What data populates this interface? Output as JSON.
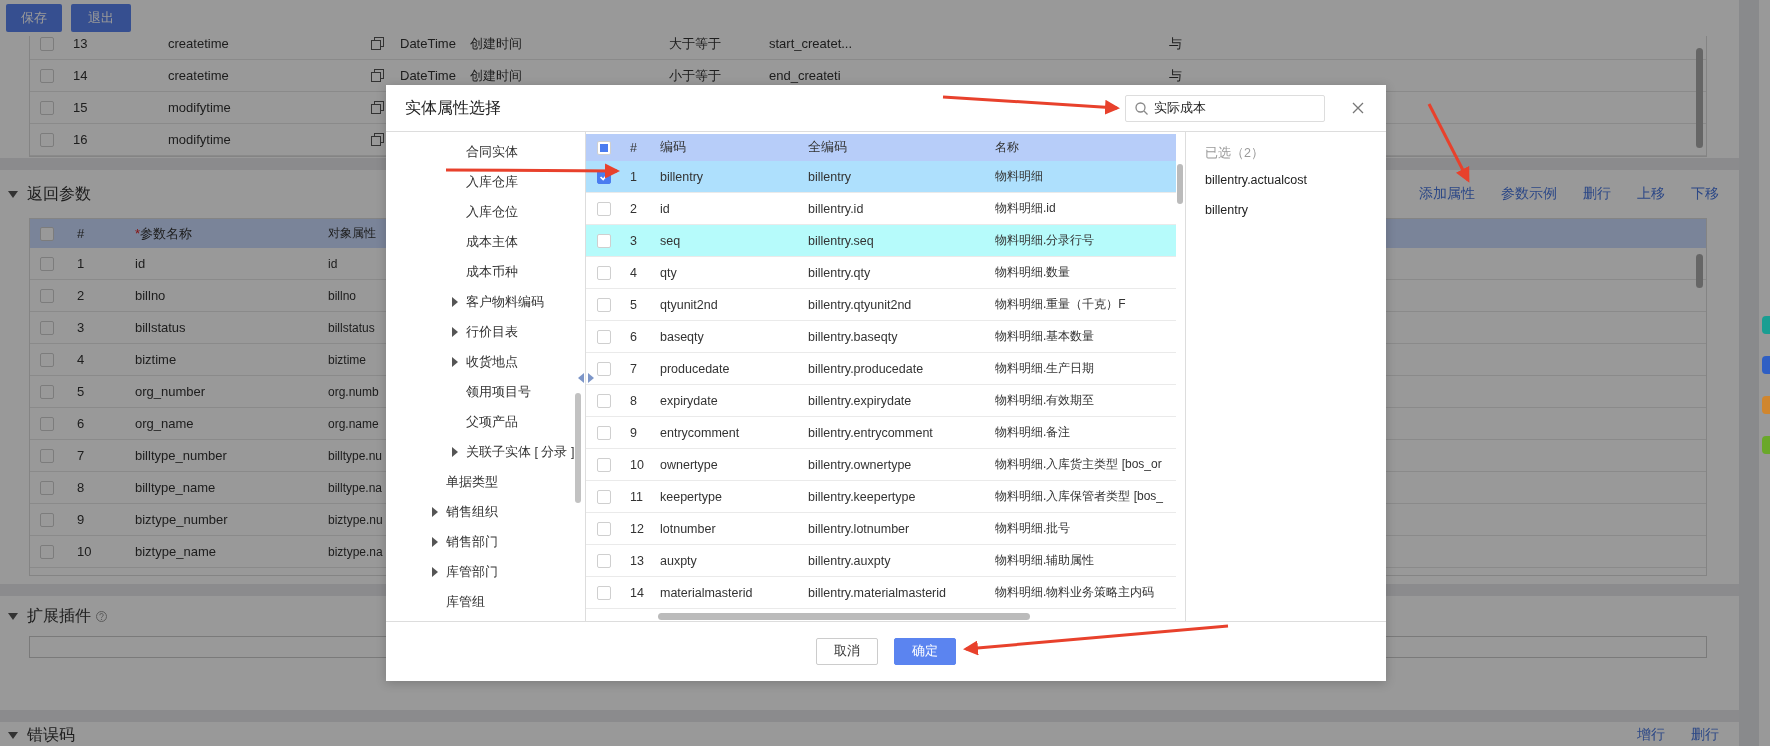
{
  "toolbar": {
    "buttons": [
      {
        "label": "保存"
      },
      {
        "label": "退出"
      }
    ]
  },
  "conditions_table": {
    "rows": [
      {
        "index": "13",
        "checked": false,
        "field": "createtime",
        "type": "DateTime",
        "label": "创建时间",
        "operator": "大于等于",
        "param": "start_createt...",
        "logic": "与"
      },
      {
        "index": "14",
        "checked": false,
        "field": "createtime",
        "type": "DateTime",
        "label": "创建时间",
        "operator": "小于等于",
        "param": "end_createti",
        "logic": "与"
      },
      {
        "index": "15",
        "checked": false,
        "field": "modifytime"
      },
      {
        "index": "16",
        "checked": false,
        "field": "modifytime"
      }
    ]
  },
  "return_params": {
    "title": "返回参数",
    "expanded": true,
    "actions": [
      "添加属性",
      "参数示例",
      "删行",
      "上移",
      "下移"
    ],
    "table": {
      "header_checked": false,
      "columns": [
        {
          "label": "#"
        },
        {
          "label": "参数名称",
          "required_mark": "*"
        },
        {
          "label": "对象属性"
        }
      ],
      "rows": [
        {
          "index": "1",
          "checked": false,
          "name": "id",
          "property": "id"
        },
        {
          "index": "2",
          "checked": false,
          "name": "billno",
          "property": "billno"
        },
        {
          "index": "3",
          "checked": false,
          "name": "billstatus",
          "property": "billstatus"
        },
        {
          "index": "4",
          "checked": false,
          "name": "biztime",
          "property": "biztime"
        },
        {
          "index": "5",
          "checked": false,
          "name": "org_number",
          "property": "org.numb"
        },
        {
          "index": "6",
          "checked": false,
          "name": "org_name",
          "property": "org.name"
        },
        {
          "index": "7",
          "checked": false,
          "name": "billtype_number",
          "property": "billtype.nu"
        },
        {
          "index": "8",
          "checked": false,
          "name": "billtype_name",
          "property": "billtype.na"
        },
        {
          "index": "9",
          "checked": false,
          "name": "biztype_number",
          "property": "biztype.nu"
        },
        {
          "index": "10",
          "checked": false,
          "name": "biztype_name",
          "property": "biztype.na"
        }
      ]
    }
  },
  "extensions": {
    "title": "扩展插件",
    "expanded": true
  },
  "error_codes": {
    "title": "错误码",
    "expanded": true,
    "actions": [
      "增行",
      "删行"
    ]
  },
  "side_tabs": [
    {
      "color": "#1a9e92"
    },
    {
      "color": "#2f5fc4"
    },
    {
      "color": "#d0862e"
    },
    {
      "color": "#6aa82a"
    }
  ],
  "dialog": {
    "title": "实体属性选择",
    "search": {
      "value": "实际成本"
    },
    "tree": {
      "items": [
        {
          "kind": "group",
          "children": [
            {
              "kind": "leaf",
              "label": "合同实体"
            },
            {
              "kind": "leaf",
              "label": "入库仓库"
            },
            {
              "kind": "leaf",
              "label": "入库仓位"
            },
            {
              "kind": "leaf",
              "label": "成本主体"
            },
            {
              "kind": "leaf",
              "label": "成本币种"
            },
            {
              "kind": "branch",
              "label": "客户物料编码",
              "expanded": false
            },
            {
              "kind": "branch",
              "label": "行价目表",
              "expanded": false
            },
            {
              "kind": "branch",
              "label": "收货地点",
              "expanded": false
            },
            {
              "kind": "leaf",
              "label": "领用项目号"
            },
            {
              "kind": "leaf",
              "label": "父项产品"
            },
            {
              "kind": "branch",
              "label": "关联子实体 [ 分录 ]",
              "expanded": false
            }
          ]
        },
        {
          "kind": "leaf",
          "label": "单据类型"
        },
        {
          "kind": "branch",
          "label": "销售组织",
          "expanded": false
        },
        {
          "kind": "branch",
          "label": "销售部门",
          "expanded": false
        },
        {
          "kind": "branch",
          "label": "库管部门",
          "expanded": false
        },
        {
          "kind": "leaf",
          "label": "库管组"
        }
      ]
    },
    "table": {
      "select_all_checked": false,
      "select_all_partial": true,
      "columns": [
        "#",
        "编码",
        "全编码",
        "名称"
      ],
      "rows": [
        {
          "index": "1",
          "checked": true,
          "selected": true,
          "hovered": false,
          "code": "billentry",
          "full_code": "billentry",
          "name": "物料明细"
        },
        {
          "index": "2",
          "checked": false,
          "selected": false,
          "hovered": false,
          "code": "id",
          "full_code": "billentry.id",
          "name": "物料明细.id"
        },
        {
          "index": "3",
          "checked": false,
          "selected": false,
          "hovered": true,
          "code": "seq",
          "full_code": "billentry.seq",
          "name": "物料明细.分录行号"
        },
        {
          "index": "4",
          "checked": false,
          "selected": false,
          "hovered": false,
          "code": "qty",
          "full_code": "billentry.qty",
          "name": "物料明细.数量"
        },
        {
          "index": "5",
          "checked": false,
          "selected": false,
          "hovered": false,
          "code": "qtyunit2nd",
          "full_code": "billentry.qtyunit2nd",
          "name": "物料明细.重量（千克）F"
        },
        {
          "index": "6",
          "checked": false,
          "selected": false,
          "hovered": false,
          "code": "baseqty",
          "full_code": "billentry.baseqty",
          "name": "物料明细.基本数量"
        },
        {
          "index": "7",
          "checked": false,
          "selected": false,
          "hovered": false,
          "code": "producedate",
          "full_code": "billentry.producedate",
          "name": "物料明细.生产日期"
        },
        {
          "index": "8",
          "checked": false,
          "selected": false,
          "hovered": false,
          "code": "expirydate",
          "full_code": "billentry.expirydate",
          "name": "物料明细.有效期至"
        },
        {
          "index": "9",
          "checked": false,
          "selected": false,
          "hovered": false,
          "code": "entrycomment",
          "full_code": "billentry.entrycomment",
          "name": "物料明细.备注"
        },
        {
          "index": "10",
          "checked": false,
          "selected": false,
          "hovered": false,
          "code": "ownertype",
          "full_code": "billentry.ownertype",
          "name": "物料明细.入库货主类型 [bos_or"
        },
        {
          "index": "11",
          "checked": false,
          "selected": false,
          "hovered": false,
          "code": "keepertype",
          "full_code": "billentry.keepertype",
          "name": "物料明细.入库保管者类型 [bos_"
        },
        {
          "index": "12",
          "checked": false,
          "selected": false,
          "hovered": false,
          "code": "lotnumber",
          "full_code": "billentry.lotnumber",
          "name": "物料明细.批号"
        },
        {
          "index": "13",
          "checked": false,
          "selected": false,
          "hovered": false,
          "code": "auxpty",
          "full_code": "billentry.auxpty",
          "name": "物料明细.辅助属性"
        },
        {
          "index": "14",
          "checked": false,
          "selected": false,
          "hovered": false,
          "code": "materialmasterid",
          "full_code": "billentry.materialmasterid",
          "name": "物料明细.物料业务策略主内码"
        }
      ]
    },
    "selected_panel": {
      "heading": "已选（2）",
      "items": [
        "billentry.actualcost",
        "billentry"
      ]
    },
    "buttons": [
      {
        "label": "取消",
        "kind": "secondary"
      },
      {
        "label": "确定",
        "kind": "primary"
      }
    ]
  }
}
